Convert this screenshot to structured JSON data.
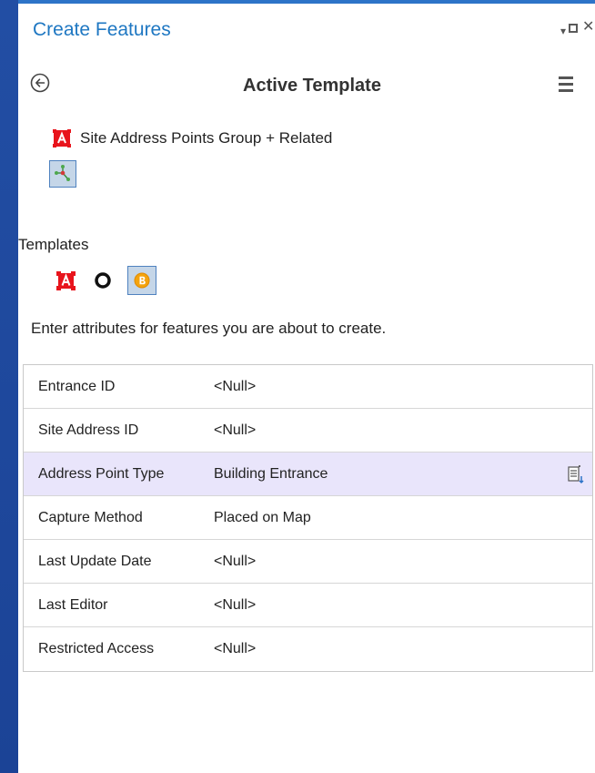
{
  "pane": {
    "title": "Create Features",
    "controls": {
      "menu_glyph": "▾",
      "close_glyph": "✕"
    }
  },
  "active_template": {
    "title": "Active Template",
    "layer_name": "Site Address Points Group + Related",
    "layer_icon": "red-address-point-icon",
    "tool_icon": "group-construct-icon"
  },
  "templates": {
    "label": "Templates",
    "items": [
      {
        "icon": "red-address-point-icon",
        "selected": false
      },
      {
        "icon": "black-circle-point-icon",
        "selected": false
      },
      {
        "icon": "orange-building-entrance-icon",
        "selected": true
      }
    ]
  },
  "instructions": "Enter attributes for features you are about to create.",
  "attributes": [
    {
      "name": "Entrance ID",
      "value": "<Null>"
    },
    {
      "name": "Site Address ID",
      "value": "<Null>"
    },
    {
      "name": "Address Point Type",
      "value": "Building Entrance"
    },
    {
      "name": "Capture Method",
      "value": "Placed on Map"
    },
    {
      "name": "Last Update Date",
      "value": "<Null>"
    },
    {
      "name": "Last Editor",
      "value": "<Null>"
    },
    {
      "name": "Restricted Access",
      "value": "<Null>"
    }
  ],
  "colors": {
    "accent": "#1e77c2",
    "desktop_bg": "#1f4aa0",
    "row_highlight": "#e9e5fb",
    "selected_button_bg": "#c5d6e8"
  }
}
